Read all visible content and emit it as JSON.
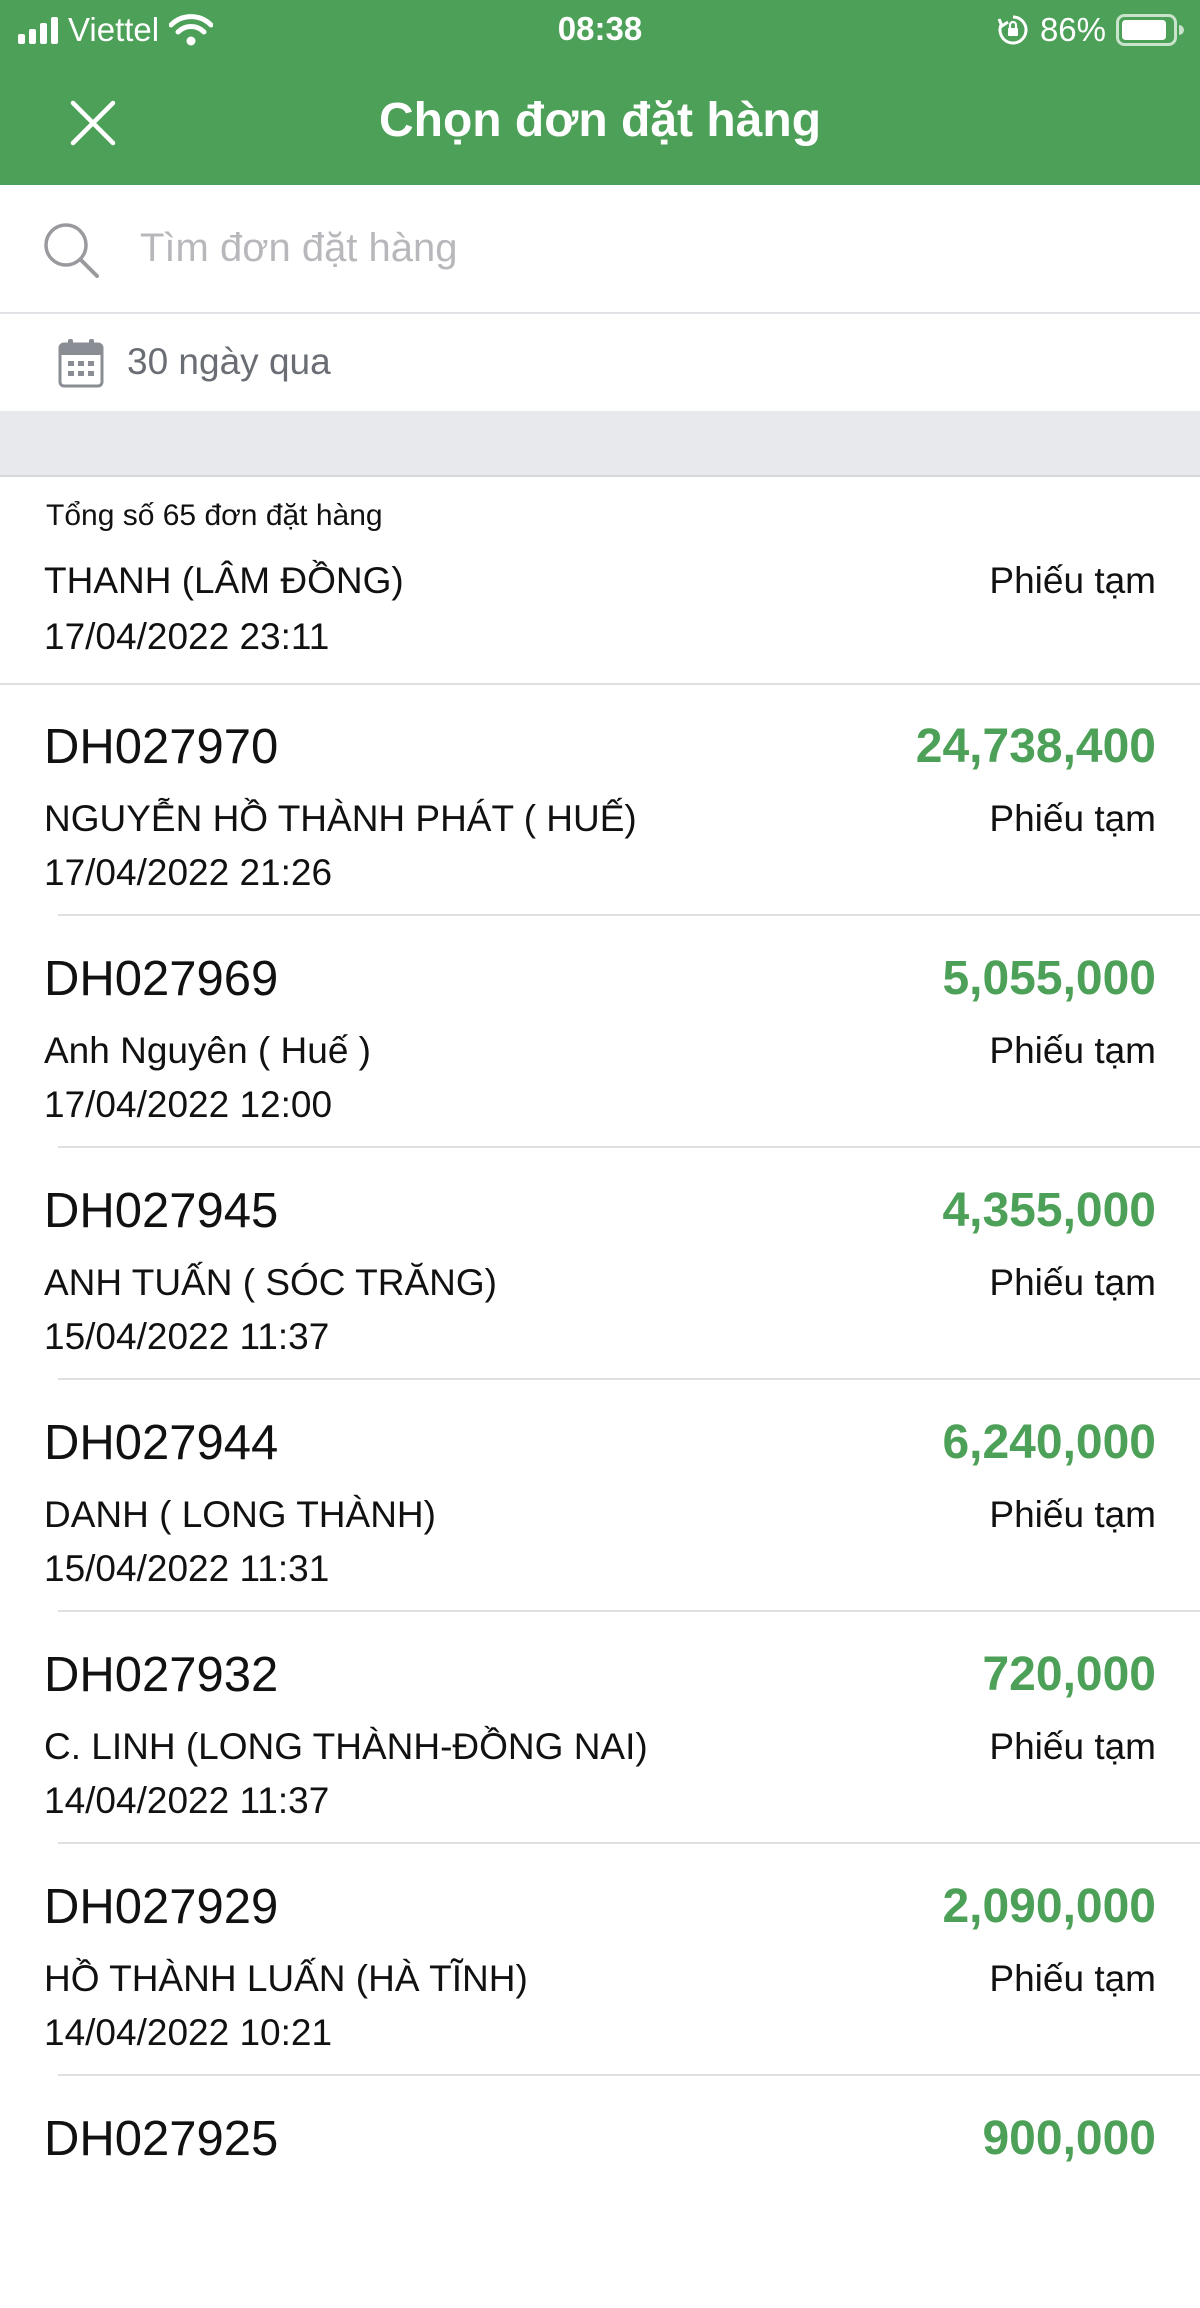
{
  "status_bar": {
    "carrier": "Viettel",
    "time": "08:38",
    "battery": "86%",
    "icons": [
      "signal-icon",
      "wifi-icon",
      "rotation-lock-icon",
      "battery-icon"
    ]
  },
  "header": {
    "title": "Chọn đơn đặt hàng",
    "close_icon": "close-icon",
    "color": "#4ca057"
  },
  "search": {
    "placeholder": "Tìm đơn đặt hàng",
    "value": "",
    "icon": "search-icon"
  },
  "filter": {
    "date_range": "30 ngày qua",
    "icon": "calendar-icon"
  },
  "list": {
    "summary": "Tổng số 65 đơn đặt hàng",
    "amount_color": "#4ca057",
    "first_item": {
      "customer": "THANH (LÂM ĐỒNG)",
      "status": "Phiếu tạm",
      "datetime": "17/04/2022 23:11"
    },
    "orders": [
      {
        "code": "DH027970",
        "amount": "24,738,400",
        "customer": "NGUYỄN HỒ THÀNH PHÁT ( HUẾ)",
        "status": "Phiếu tạm",
        "datetime": "17/04/2022 21:26"
      },
      {
        "code": "DH027969",
        "amount": "5,055,000",
        "customer": "Anh Nguyên ( Huế )",
        "status": "Phiếu tạm",
        "datetime": "17/04/2022 12:00"
      },
      {
        "code": "DH027945",
        "amount": "4,355,000",
        "customer": "ANH TUẤN ( SÓC TRĂNG)",
        "status": "Phiếu tạm",
        "datetime": "15/04/2022 11:37"
      },
      {
        "code": "DH027944",
        "amount": "6,240,000",
        "customer": "DANH ( LONG THÀNH)",
        "status": "Phiếu tạm",
        "datetime": "15/04/2022 11:31"
      },
      {
        "code": "DH027932",
        "amount": "720,000",
        "customer": "C. LINH (LONG THÀNH-ĐỒNG NAI)",
        "status": "Phiếu tạm",
        "datetime": "14/04/2022 11:37"
      },
      {
        "code": "DH027929",
        "amount": "2,090,000",
        "customer": "HỒ THÀNH LUẤN (HÀ TĨNH)",
        "status": "Phiếu tạm",
        "datetime": "14/04/2022 10:21"
      },
      {
        "code": "DH027925",
        "amount": "900,000",
        "customer": "",
        "status": "",
        "datetime": ""
      }
    ]
  }
}
